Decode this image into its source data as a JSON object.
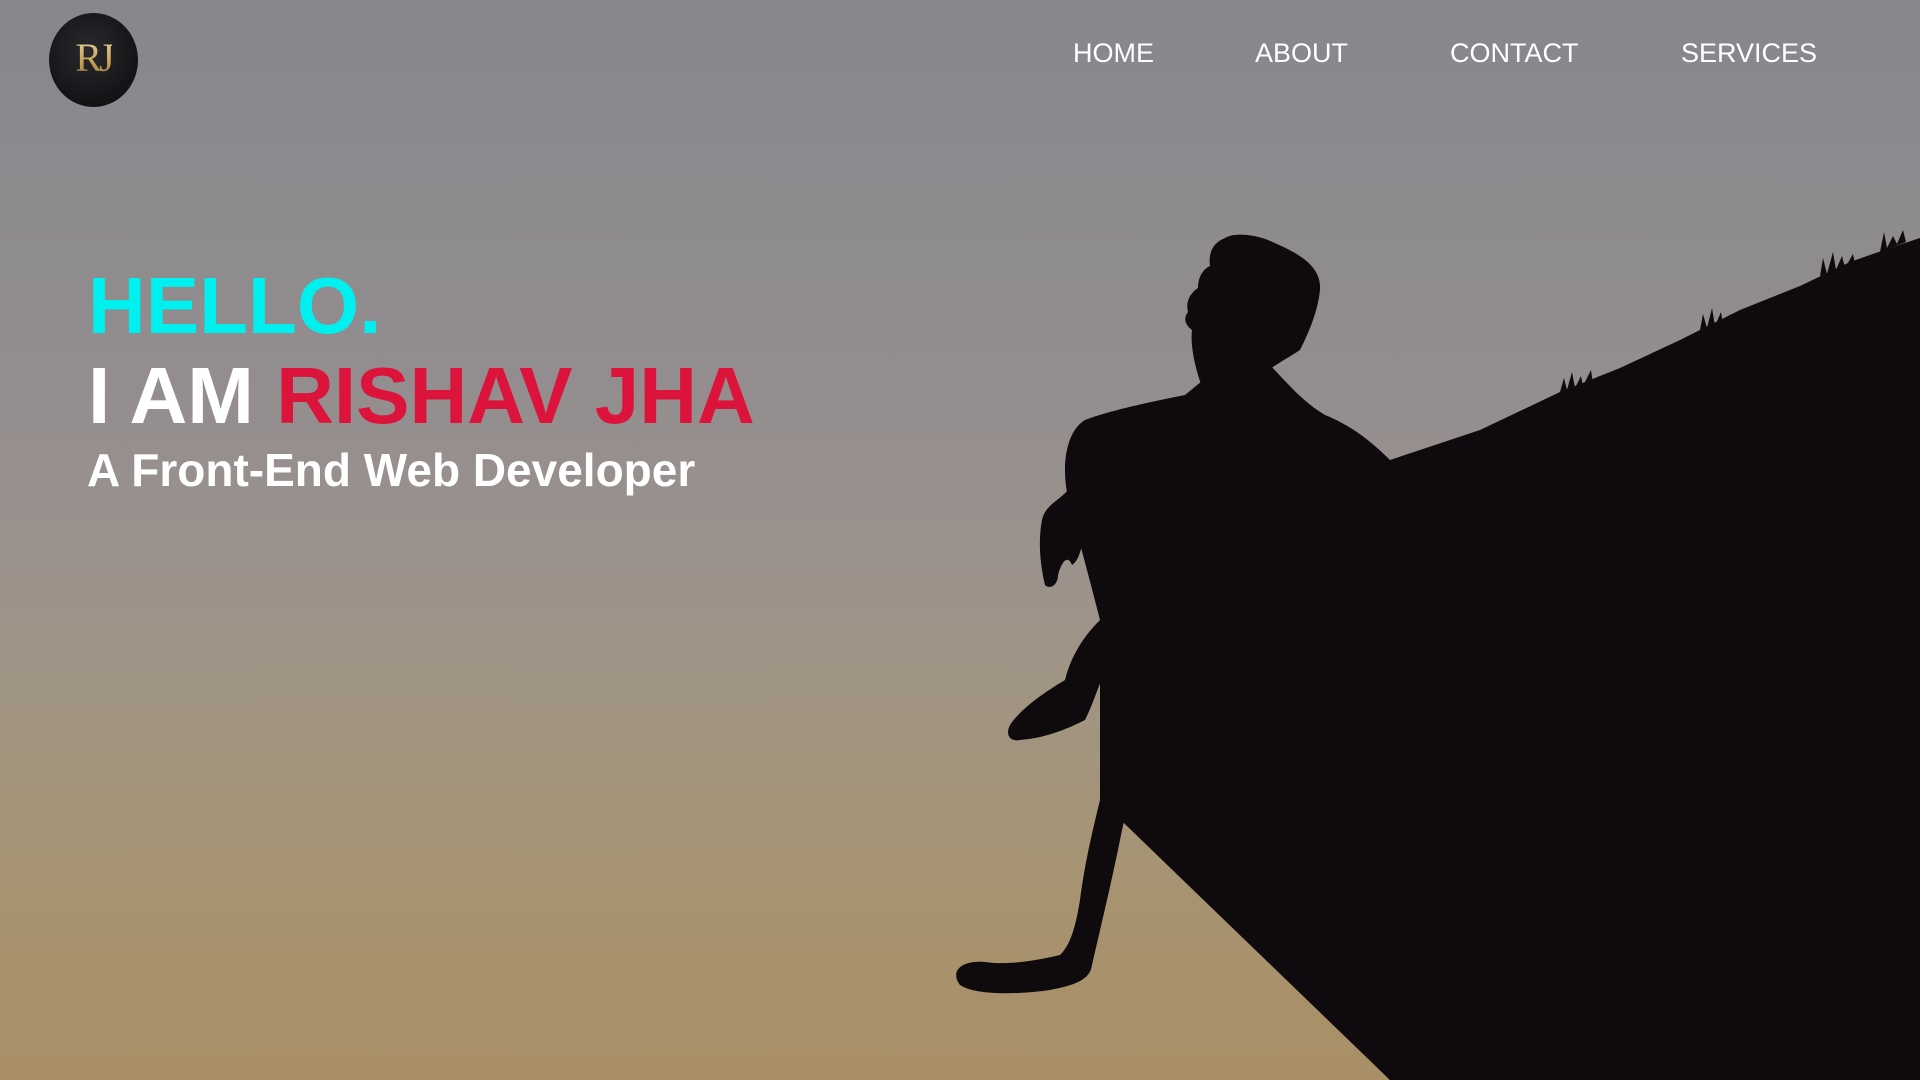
{
  "logo": {
    "text": "RJ",
    "color_gold": "#c9a65a"
  },
  "nav": {
    "items": [
      {
        "label": "HOME"
      },
      {
        "label": "ABOUT"
      },
      {
        "label": "CONTACT"
      },
      {
        "label": "SERVICES"
      }
    ]
  },
  "hero": {
    "greeting": "HELLO.",
    "intro_prefix": "I AM",
    "name": "RISHAV JHA",
    "role": "A Front-End Web Developer",
    "colors": {
      "greeting": "#00f0f0",
      "name": "#dc143c",
      "text": "#ffffff"
    },
    "background_image": "silhouette of a person sitting on a hill edge at dusk"
  }
}
